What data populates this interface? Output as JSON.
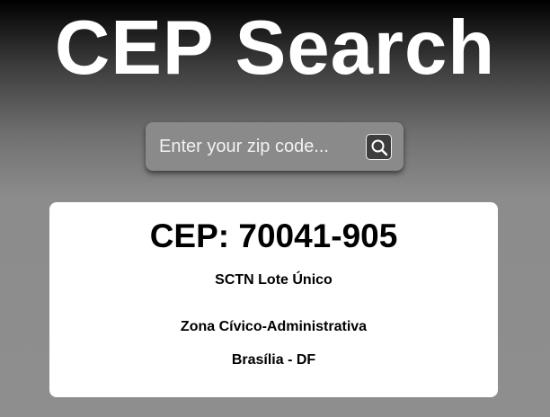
{
  "header": {
    "title": "CEP Search"
  },
  "search": {
    "value": "",
    "placeholder": "Enter your zip code...",
    "button_icon": "search-icon"
  },
  "result": {
    "cep_label": "CEP: 70041-905",
    "street": "SCTN Lote Único",
    "district": "Zona Cívico-Administrativa",
    "city_state": "Brasília - DF"
  },
  "colors": {
    "title_text": "#ffffff",
    "search_background": "#8a8a8a",
    "search_button_background": "#3d3d3d",
    "card_background": "#ffffff",
    "card_text": "#000000"
  }
}
